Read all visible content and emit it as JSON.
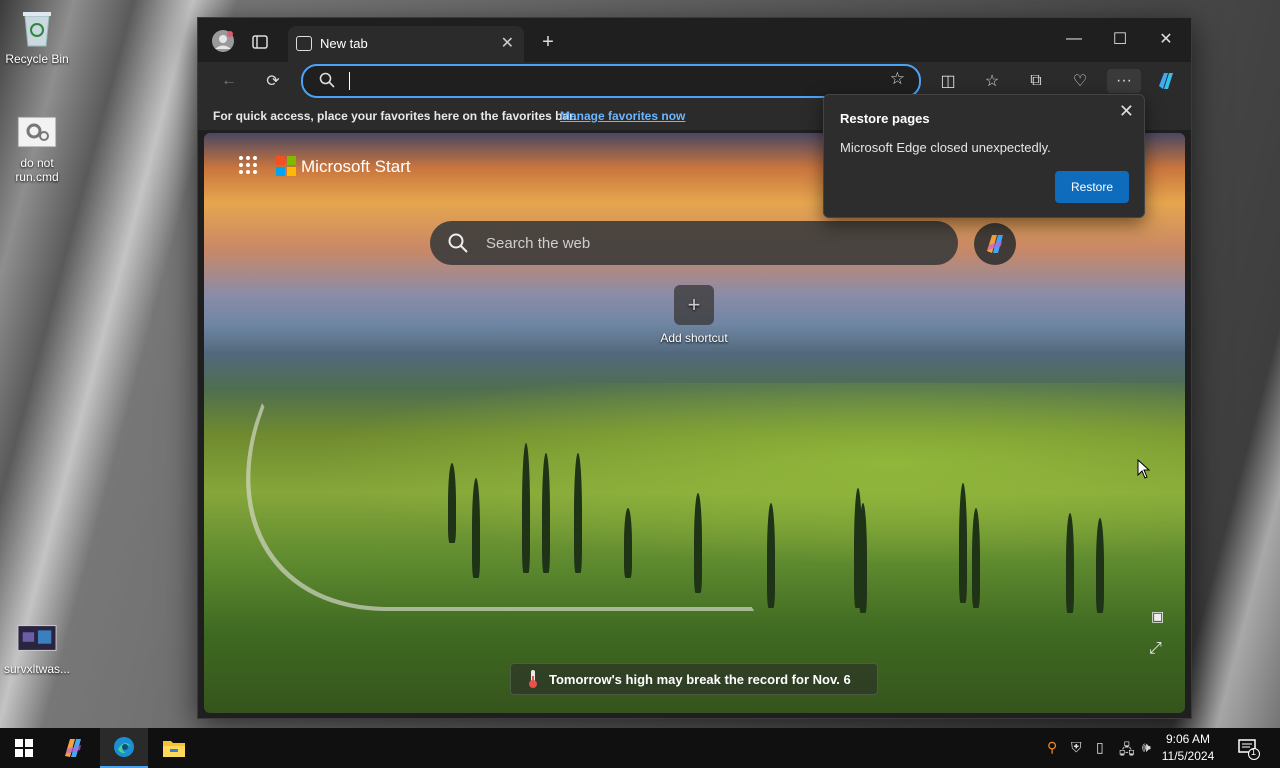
{
  "desktop": {
    "icons": [
      {
        "label": "Recycle Bin"
      },
      {
        "label": "do not run.cmd"
      },
      {
        "label": "survxltwas..."
      }
    ]
  },
  "browser": {
    "tab": {
      "title": "New tab"
    },
    "favorites_bar": {
      "message": "For quick access, place your favorites here on the favorites bar.",
      "link": "Manage favorites now"
    },
    "address_bar": {
      "value": "",
      "accent": "#4ba3f5"
    }
  },
  "newtab": {
    "brand": "Microsoft Start",
    "search_placeholder": "Search the web",
    "add_shortcut": "Add shortcut",
    "news": "Tomorrow's high may break the record for Nov. 6"
  },
  "popup": {
    "title": "Restore pages",
    "message": "Microsoft Edge closed unexpectedly.",
    "button": "Restore",
    "button_color": "#0f6cbd"
  },
  "taskbar": {
    "time": "9:06 AM",
    "date": "11/5/2024",
    "notification_count": "1"
  }
}
